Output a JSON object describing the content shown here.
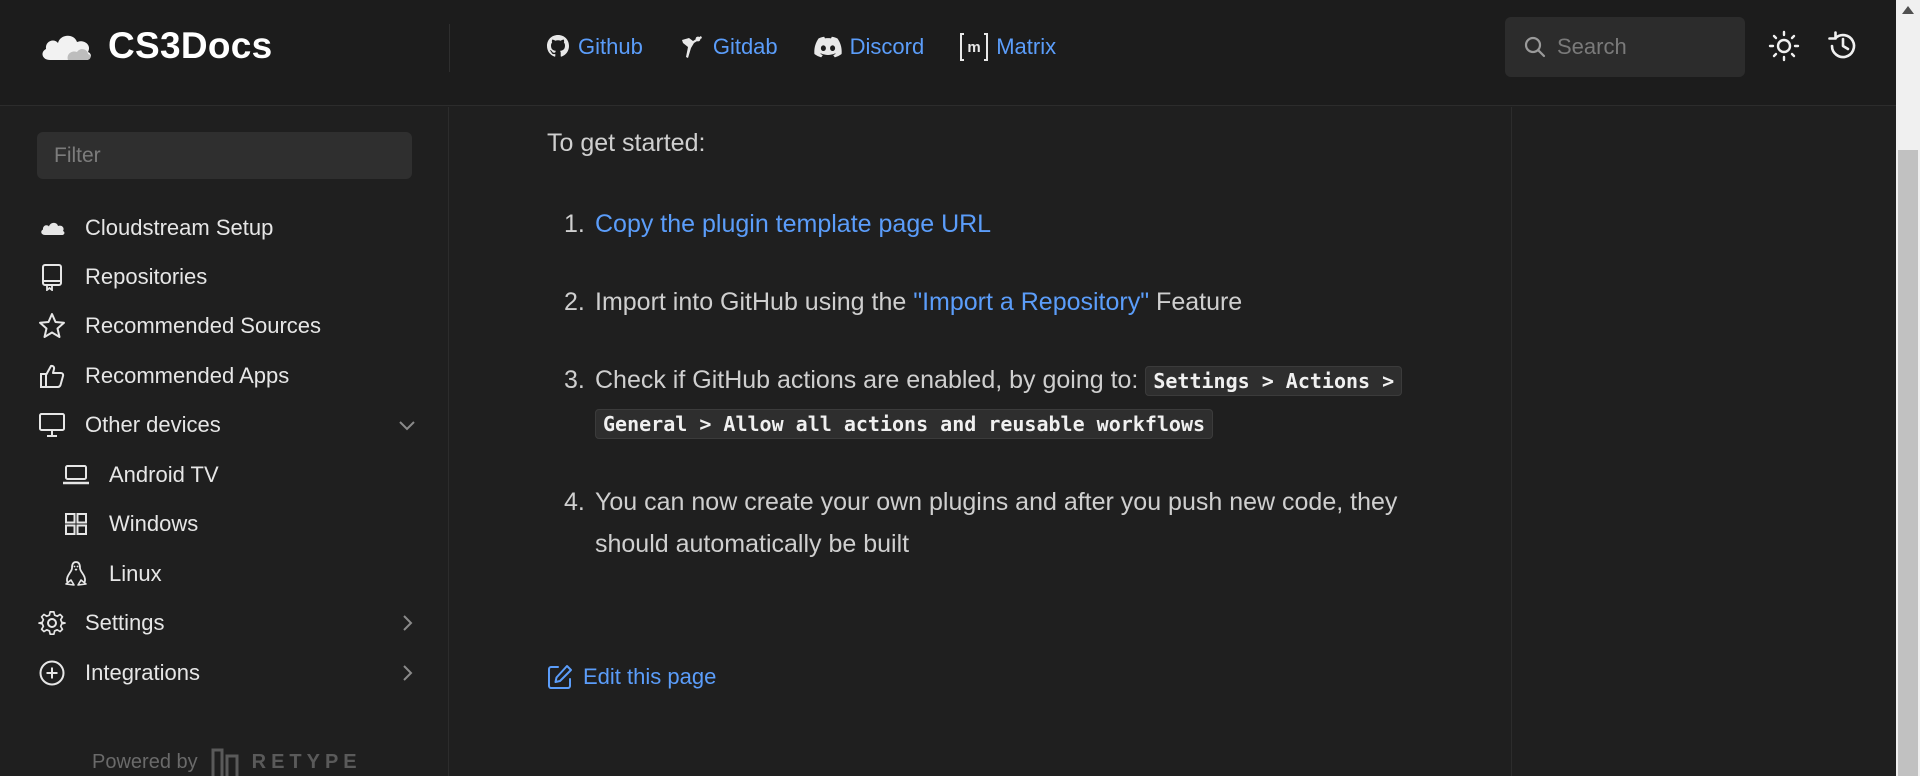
{
  "header": {
    "title": "CS3Docs",
    "links": [
      {
        "label": "Github",
        "icon": "github-icon"
      },
      {
        "label": "Gitdab",
        "icon": "gitdab-icon"
      },
      {
        "label": "Discord",
        "icon": "discord-icon"
      },
      {
        "label": "Matrix",
        "icon": "matrix-icon"
      }
    ],
    "search_placeholder": "Search"
  },
  "sidebar": {
    "filter_placeholder": "Filter",
    "items": [
      {
        "label": "Cloudstream Setup",
        "icon": "cloud-icon"
      },
      {
        "label": "Repositories",
        "icon": "repo-icon"
      },
      {
        "label": "Recommended Sources",
        "icon": "star-icon"
      },
      {
        "label": "Recommended Apps",
        "icon": "thumbs-up-icon"
      },
      {
        "label": "Other devices",
        "icon": "monitor-icon",
        "expanded": true
      },
      {
        "label": "Android TV",
        "icon": "laptop-icon"
      },
      {
        "label": "Windows",
        "icon": "windows-icon"
      },
      {
        "label": "Linux",
        "icon": "linux-icon"
      },
      {
        "label": "Settings",
        "icon": "gear-icon"
      },
      {
        "label": "Integrations",
        "icon": "plus-circle-icon"
      }
    ],
    "powered_by": "Powered by",
    "retype": "RETYPE"
  },
  "content": {
    "intro": "To get started:",
    "steps": [
      {
        "num": "1.",
        "link": "Copy the plugin template page URL"
      },
      {
        "num": "2.",
        "pre": "Import into GitHub using the ",
        "link": "\"Import a Repository\"",
        "post": " Feature"
      },
      {
        "num": "3.",
        "pre": "Check if GitHub actions are enabled, by going to: ",
        "code_a": "Settings > Actions >",
        "code_b": "General > Allow all actions and reusable workflows"
      },
      {
        "num": "4.",
        "text": "You can now create your own plugins and after you push new code, they should automatically be built"
      }
    ],
    "edit_label": "Edit this page"
  },
  "colors": {
    "background": "#1f1f1f",
    "link": "#5b9dfa",
    "text": "#cfcfcf"
  }
}
